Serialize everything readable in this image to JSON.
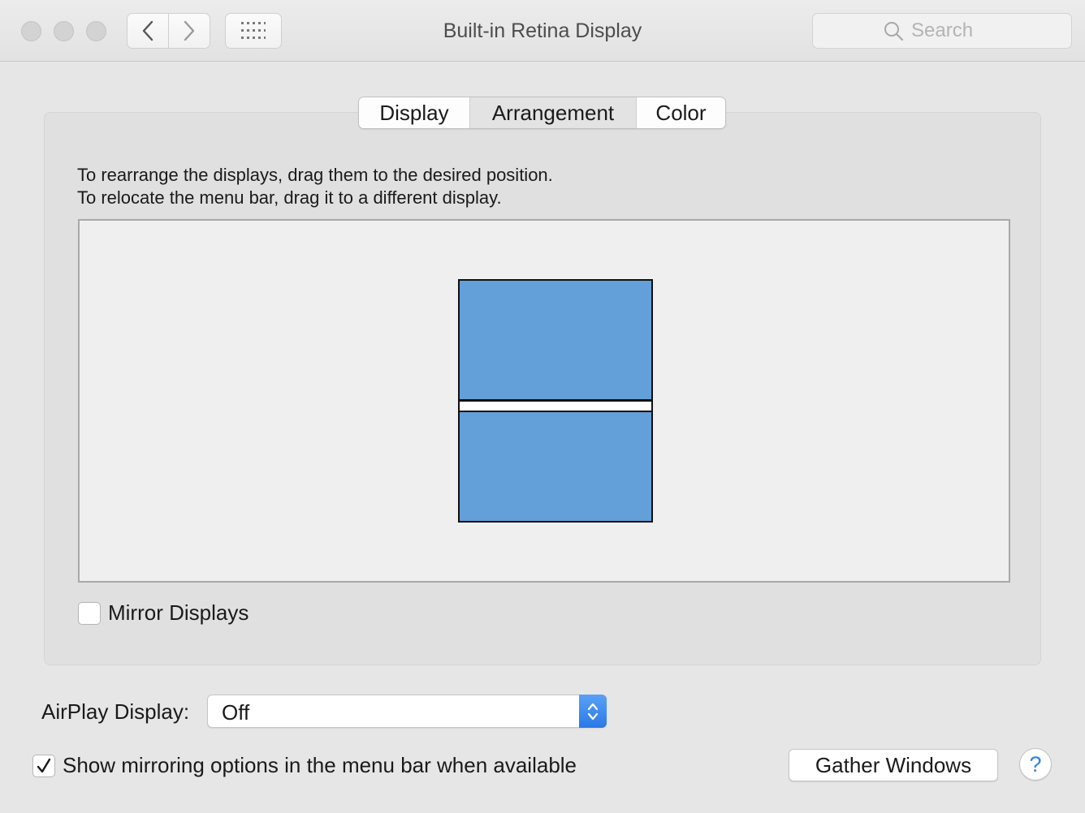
{
  "window": {
    "title": "Built-in Retina Display"
  },
  "toolbar": {
    "back_icon": "chevron-left-icon",
    "forward_icon": "chevron-right-icon",
    "grid_icon": "show-all-grid-icon",
    "search": {
      "placeholder": "Search",
      "icon": "search-icon"
    }
  },
  "tabs": [
    {
      "label": "Display",
      "selected": false
    },
    {
      "label": "Arrangement",
      "selected": true
    },
    {
      "label": "Color",
      "selected": false
    }
  ],
  "arrangement": {
    "instruction_line1": "To rearrange the displays, drag them to the desired position.",
    "instruction_line2": "To relocate the menu bar, drag it to a different display.",
    "display_color": "#639fd8",
    "mirror": {
      "label": "Mirror Displays",
      "checked": false
    }
  },
  "airplay": {
    "label": "AirPlay Display:",
    "selected_value": "Off"
  },
  "show_mirroring": {
    "label": "Show mirroring options in the menu bar when available",
    "checked": true
  },
  "buttons": {
    "gather_windows": "Gather Windows",
    "help": "?"
  }
}
